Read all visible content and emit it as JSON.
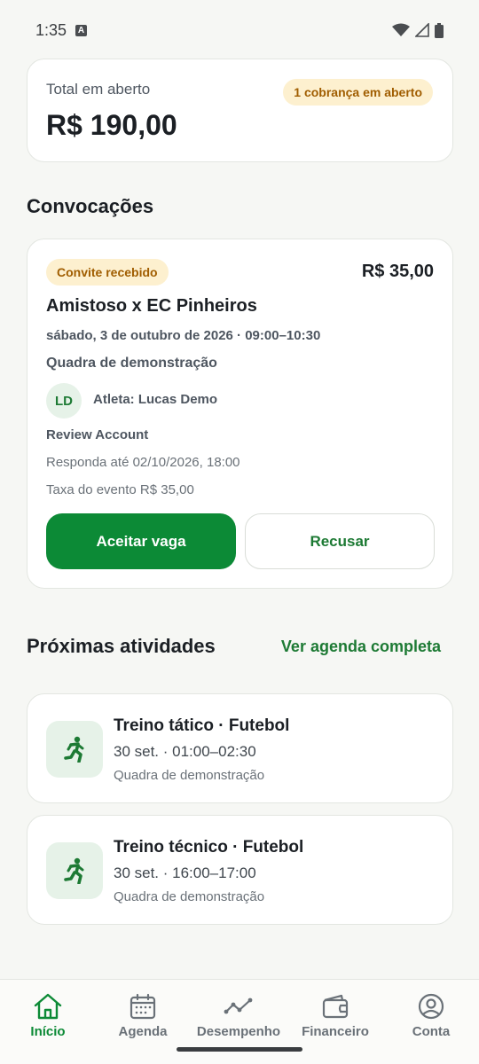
{
  "status_bar": {
    "time": "1:35"
  },
  "summary": {
    "label": "Total em aberto",
    "value": "R$ 190,00",
    "badge": "1 cobrança em aberto"
  },
  "invites": {
    "section_title": "Convocações",
    "card": {
      "badge": "Convite recebido",
      "price": "R$ 35,00",
      "title": "Amistoso x EC Pinheiros",
      "datetime": "sábado, 3 de outubro de 2026 · 09:00–10:30",
      "venue": "Quadra de demonstração",
      "avatar_initials": "LD",
      "athlete": "Atleta: Lucas Demo",
      "account": "Review Account",
      "deadline": "Responda até 02/10/2026, 18:00",
      "fee": "Taxa do evento R$ 35,00",
      "accept_label": "Aceitar vaga",
      "decline_label": "Recusar"
    }
  },
  "activities": {
    "section_title": "Próximas atividades",
    "see_all": "Ver agenda completa",
    "items": [
      {
        "title": "Treino tático · Futebol",
        "time": "30 set. · 01:00–02:30",
        "venue": "Quadra de demonstração",
        "icon": "running-icon"
      },
      {
        "title": "Treino técnico · Futebol",
        "time": "30 set. · 16:00–17:00",
        "venue": "Quadra de demonstração",
        "icon": "running-icon"
      }
    ]
  },
  "nav": {
    "items": [
      {
        "label": "Início",
        "icon": "home-icon",
        "active": true
      },
      {
        "label": "Agenda",
        "icon": "calendar-icon",
        "active": false
      },
      {
        "label": "Desempenho",
        "icon": "trend-icon",
        "active": false
      },
      {
        "label": "Financeiro",
        "icon": "wallet-icon",
        "active": false
      },
      {
        "label": "Conta",
        "icon": "account-icon",
        "active": false
      }
    ]
  },
  "colors": {
    "accent": "#0c8a36",
    "badge_bg": "#fdf0cf",
    "badge_text": "#a05d00"
  }
}
